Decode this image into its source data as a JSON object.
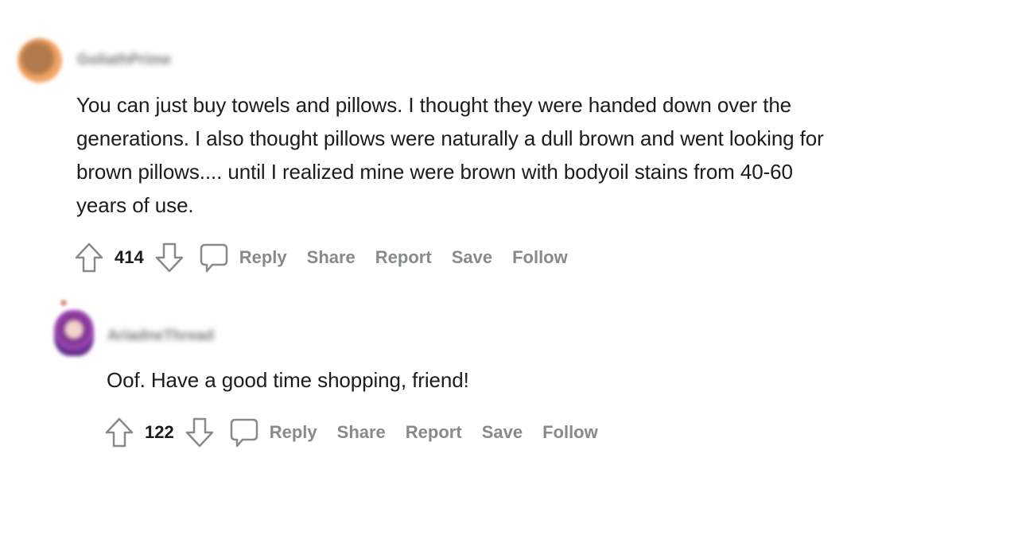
{
  "comments": [
    {
      "username": "GoliathPrime",
      "avatar": "user-avatar-orange",
      "body_lines": [
        "You can just buy towels and pillows. I thought they were handed down over the",
        "generations. I also thought pillows were naturally a dull brown and went looking for",
        "brown pillows.... until I realized mine were brown with bodyoil stains from 40-60",
        "years of use."
      ],
      "score": "414",
      "actions": {
        "reply": "Reply",
        "share": "Share",
        "report": "Report",
        "save": "Save",
        "follow": "Follow"
      }
    },
    {
      "username": "AriadneThread",
      "avatar": "user-avatar-purple",
      "body_lines": [
        "Oof. Have a good time shopping, friend!"
      ],
      "score": "122",
      "actions": {
        "reply": "Reply",
        "share": "Share",
        "report": "Report",
        "save": "Save",
        "follow": "Follow"
      }
    }
  ],
  "icons": {
    "upvote": "upvote-arrow-icon",
    "downvote": "downvote-arrow-icon",
    "reply": "speech-bubble-icon"
  },
  "colors": {
    "text": "#1c1c1c",
    "action_text": "#878a8c",
    "icon_stroke": "#878a8c",
    "background": "#ffffff"
  }
}
